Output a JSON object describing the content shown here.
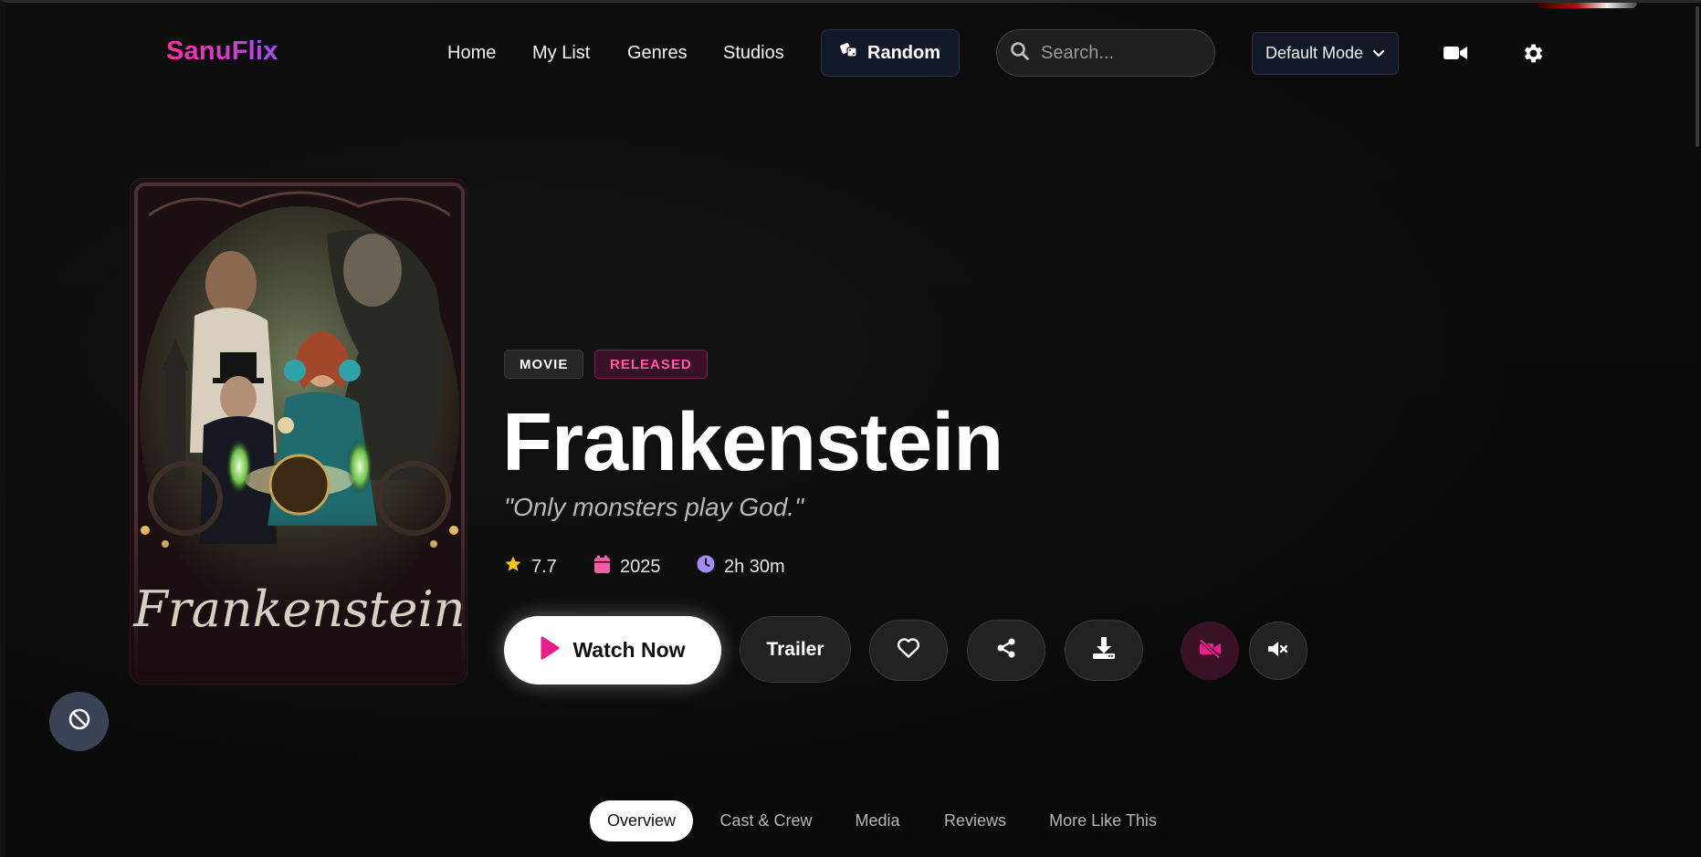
{
  "app": {
    "logo": "SanuFlix"
  },
  "nav": {
    "links": [
      "Home",
      "My List",
      "Genres",
      "Studios"
    ],
    "random_label": "Random",
    "search_placeholder": "Search...",
    "mode_value": "Default Mode"
  },
  "hero": {
    "badges": [
      "MOVIE",
      "RELEASED"
    ],
    "title": "Frankenstein",
    "tagline": "\"Only monsters play God.\"",
    "rating": "7.7",
    "year": "2025",
    "runtime": "2h 30m",
    "poster_script_title": "Frankenstein",
    "actions": {
      "watch_label": "Watch Now",
      "trailer_label": "Trailer"
    }
  },
  "tabs": [
    "Overview",
    "Cast & Crew",
    "Media",
    "Reviews",
    "More Like This"
  ],
  "active_tab": "Overview",
  "colors": {
    "accent_pink": "#e91e8c",
    "accent_purple": "#a64bf4",
    "star": "#f5c518",
    "calendar": "#ff5aa6",
    "clock": "#a78bfa"
  },
  "icons": {
    "random": "dice-icon",
    "search": "search-icon",
    "mode": "chevron-down-icon",
    "camera": "video-camera-icon",
    "settings": "gear-icon",
    "favorite": "heart-icon",
    "share": "share-icon",
    "download": "download-icon",
    "video_off": "video-off-icon",
    "mute": "mute-icon",
    "block": "block-icon"
  }
}
